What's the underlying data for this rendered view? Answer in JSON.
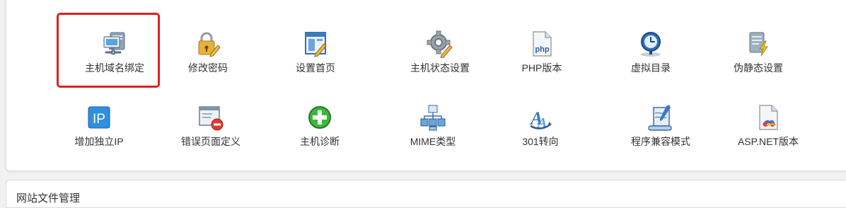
{
  "tools": {
    "row1": [
      {
        "label": "主机域名绑定",
        "icon": "server-link-icon",
        "selected": true
      },
      {
        "label": "修改密码",
        "icon": "padlock-pencil-icon"
      },
      {
        "label": "设置首页",
        "icon": "window-edit-icon"
      },
      {
        "label": "主机状态设置",
        "icon": "gear-pencil-icon"
      },
      {
        "label": "PHP版本",
        "icon": "php-file-icon",
        "icon_text": "php"
      },
      {
        "label": "虚拟目录",
        "icon": "globe-clock-icon"
      },
      {
        "label": "伪静态设置",
        "icon": "document-lightning-icon"
      }
    ],
    "row2": [
      {
        "label": "增加独立IP",
        "icon": "ip-badge-icon",
        "icon_text": "IP"
      },
      {
        "label": "错误页面定义",
        "icon": "error-page-icon"
      },
      {
        "label": "主机诊断",
        "icon": "green-plus-icon"
      },
      {
        "label": "MIME类型",
        "icon": "sitemap-icon"
      },
      {
        "label": "301转向",
        "icon": "redirect-arrow-icon"
      },
      {
        "label": "程序兼容模式",
        "icon": "scroll-pen-icon"
      },
      {
        "label": "ASP.NET版本",
        "icon": "dotnet-file-icon"
      }
    ]
  },
  "next_section": {
    "title": "网站文件管理"
  },
  "colors": {
    "selection_border": "#e02020",
    "panel_bg": "#ffffff",
    "page_bg": "#f1f1f1"
  }
}
